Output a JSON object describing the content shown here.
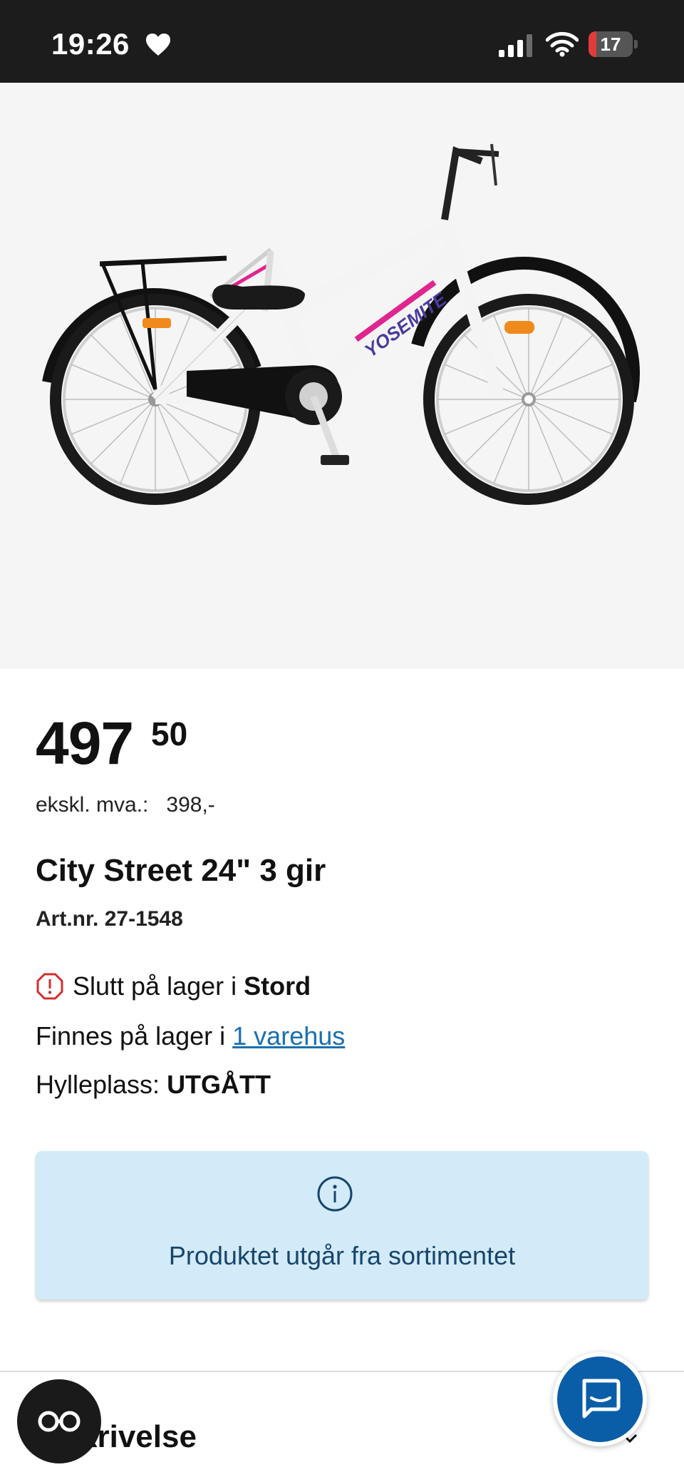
{
  "status_bar": {
    "time": "19:26",
    "battery_level": "17",
    "battery_fraction": 0.17,
    "battery_color": "#e23b3b",
    "icons": [
      "heart-icon",
      "signal-icon",
      "wifi-icon",
      "battery-icon"
    ]
  },
  "product_image": {
    "frame_text": "YOSEMITE",
    "background": "#f5f5f5"
  },
  "price": {
    "main": "497",
    "cents": "50"
  },
  "ex_vat": {
    "label": "ekskl. mva.:",
    "value": "398,-"
  },
  "product": {
    "title": "City Street 24\" 3 gir",
    "art_label": "Art.nr.",
    "art_number": "27-1548"
  },
  "stock": {
    "out_of_stock_text": "Slutt på lager i ",
    "out_of_stock_store": "Stord",
    "available_text": "Finnes på lager i ",
    "available_link": "1 varehus",
    "shelf_label": "Hylleplass: ",
    "shelf_value": "UTGÅTT",
    "warning_color": "#d32f2f",
    "link_color": "#1a6fb0"
  },
  "info_box": {
    "text": "Produktet utgår fra sortimentet",
    "icon": "info-icon",
    "background": "#d3eaf9"
  },
  "description": {
    "title": "krivelse",
    "icon": "chevron-down-icon"
  },
  "floating": {
    "accessibility_icon": "glasses-icon",
    "chat_icon": "chat-icon",
    "chat_color": "#0a5ea8"
  }
}
